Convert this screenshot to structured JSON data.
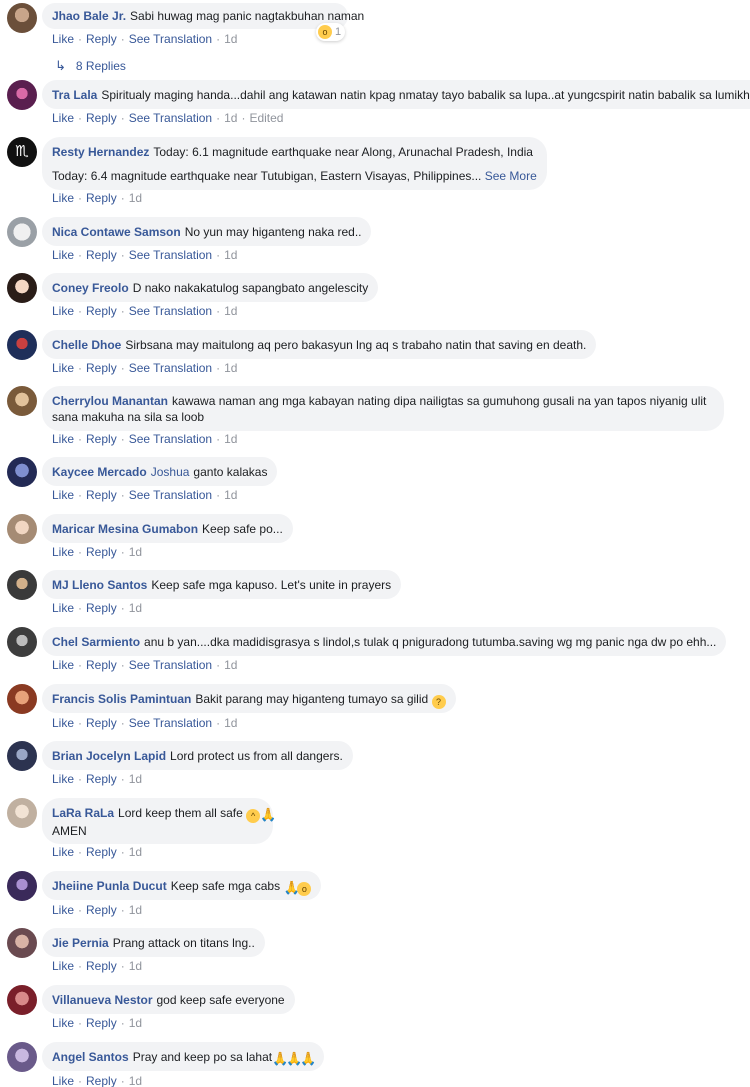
{
  "actions": {
    "like": "Like",
    "reply": "Reply",
    "see_translation": "See Translation",
    "see_more": "See More",
    "edited": "Edited",
    "separator": "·"
  },
  "colors": {
    "link": "#385898",
    "bubble": "#f2f3f5",
    "meta": "#90949c"
  },
  "comments": [
    {
      "author": "Jhao Bale Jr.",
      "text": "Sabi huwag mag panic nagtakbuhan naman",
      "time": "1d",
      "reaction_count": "1",
      "replies": "8 Replies"
    },
    {
      "author": "Tra Lala",
      "text": "Spiritualy maging handa...dahil ang katawan natin kpag nmatay tayo babalik sa lupa..at yungcspirit natin babalik sa lumikha",
      "time": "1d"
    },
    {
      "author": "Resty Hernandez",
      "text": "Today: 6.1 magnitude earthquake near Along, Arunachal Pradesh, India",
      "text2": "Today: 6.4 magnitude earthquake near Tutubigan, Eastern Visayas, Philippines...",
      "time": "1d"
    },
    {
      "author": "Nica Contawe Samson",
      "text": "No yun may higanteng naka red..",
      "time": "1d"
    },
    {
      "author": "Coney Freolo",
      "text": "D nako nakakatulog sapangbato angelescity",
      "time": "1d"
    },
    {
      "author": "Chelle Dhoe",
      "text": "Sirbsana may maitulong aq pero bakasyun lng aq s trabaho natin that saving en death.",
      "time": "1d"
    },
    {
      "author": "Cherrylou Manantan",
      "text": "kawawa naman ang mga kabayan nating dipa nailigtas sa gumuhong gusali na yan tapos niyanig ulit sana makuha na sila sa loob",
      "time": "1d"
    },
    {
      "author": "Kaycee Mercado",
      "tag": "Joshua",
      "text": "ganto kalakas",
      "time": "1d"
    },
    {
      "author": "Maricar Mesina Gumabon",
      "text": "Keep safe po...",
      "time": "1d"
    },
    {
      "author": "MJ Lleno Santos",
      "text": "Keep safe mga kapuso. Let's unite in prayers",
      "time": "1d"
    },
    {
      "author": "Chel Sarmiento",
      "text": "anu b yan....dka madidisgrasya s lindol,s tulak q pniguradong tutumba.saving wg mg panic nga dw po ehh...",
      "time": "1d"
    },
    {
      "author": "Francis Solis Pamintuan",
      "text": "Bakit parang may higanteng tumayo sa gilid",
      "time": "1d"
    },
    {
      "author": "Brian Jocelyn Lapid",
      "text": "Lord protect us from all dangers.",
      "time": "1d"
    },
    {
      "author": "LaRa RaLa",
      "text": "Lord keep them all safe",
      "text2": "AMEN",
      "time": "1d"
    },
    {
      "author": "Jheiine Punla Ducut",
      "text": "Keep safe mga cabs",
      "time": "1d"
    },
    {
      "author": "Jie Pernia",
      "text": "Prang attack on titans lng..",
      "time": "1d"
    },
    {
      "author": "Villanueva Nestor",
      "text": "god keep safe everyone",
      "time": "1d"
    },
    {
      "author": "Angel Santos",
      "text": "Pray and keep po sa lahat",
      "time": "1d"
    }
  ]
}
